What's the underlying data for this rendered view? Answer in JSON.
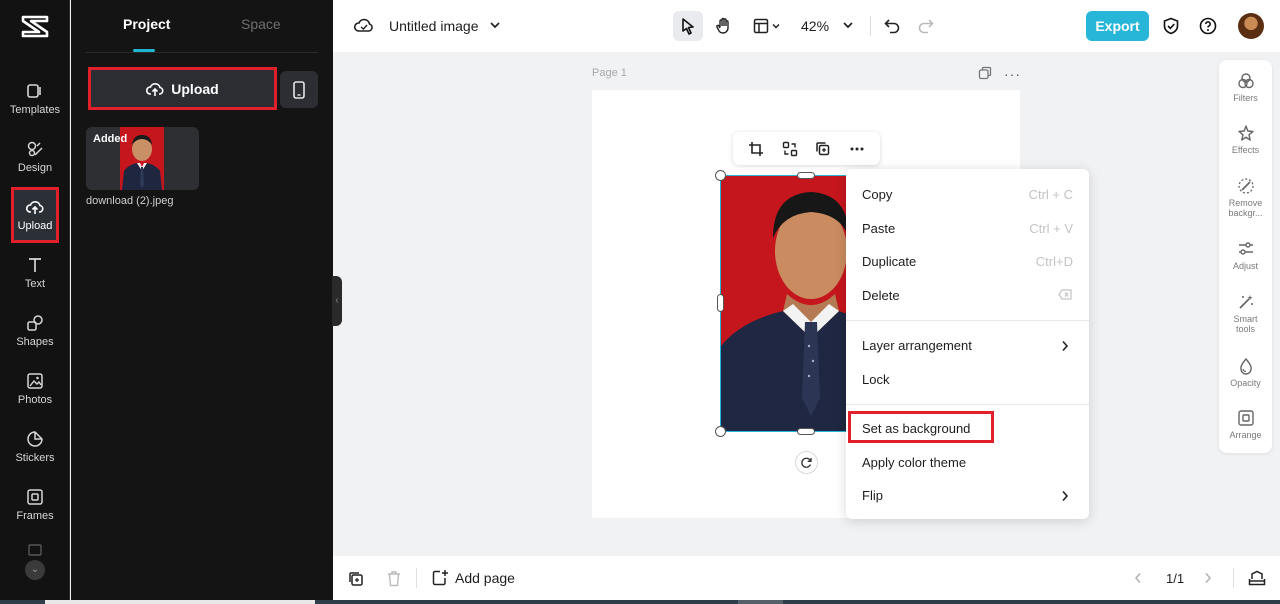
{
  "rail": {
    "items": [
      {
        "label": "Templates",
        "icon": "templates-icon"
      },
      {
        "label": "Design",
        "icon": "design-icon"
      },
      {
        "label": "Upload",
        "icon": "upload-cloud-icon",
        "active": true
      },
      {
        "label": "Text",
        "icon": "text-icon"
      },
      {
        "label": "Shapes",
        "icon": "shapes-icon"
      },
      {
        "label": "Photos",
        "icon": "photos-icon"
      },
      {
        "label": "Stickers",
        "icon": "stickers-icon"
      },
      {
        "label": "Frames",
        "icon": "frames-icon"
      }
    ]
  },
  "panel": {
    "tabs": [
      {
        "label": "Project",
        "active": true
      },
      {
        "label": "Space",
        "active": false
      }
    ],
    "upload_label": "Upload",
    "asset": {
      "badge": "Added",
      "filename": "download (2).jpeg"
    }
  },
  "topbar": {
    "title": "Untitled image",
    "zoom": "42%",
    "export_label": "Export"
  },
  "canvas": {
    "page_label": "Page 1"
  },
  "context_menu": {
    "items": [
      {
        "label": "Copy",
        "shortcut": "Ctrl + C"
      },
      {
        "label": "Paste",
        "shortcut": "Ctrl + V"
      },
      {
        "label": "Duplicate",
        "shortcut": "Ctrl+D"
      },
      {
        "label": "Delete"
      },
      {
        "label": "Layer arrangement",
        "submenu": true
      },
      {
        "label": "Lock"
      },
      {
        "label": "Set as background",
        "highlighted": true
      },
      {
        "label": "Apply color theme"
      },
      {
        "label": "Flip",
        "submenu": true
      }
    ]
  },
  "right_tools": {
    "items": [
      {
        "label": "Filters",
        "icon": "filters-icon"
      },
      {
        "label": "Effects",
        "icon": "effects-icon"
      },
      {
        "label": "Remove backgr...",
        "icon": "remove-background-icon"
      },
      {
        "label": "Adjust",
        "icon": "adjust-icon"
      },
      {
        "label": "Smart tools",
        "icon": "smart-tools-icon"
      },
      {
        "label": "Opacity",
        "icon": "opacity-icon"
      },
      {
        "label": "Arrange",
        "icon": "arrange-icon"
      }
    ]
  },
  "bottombar": {
    "add_page_label": "Add page",
    "page_count": "1/1"
  },
  "colors": {
    "accent": "#27b5d8",
    "highlight_box": "#e2202b",
    "sidebar_bg": "#121212",
    "photo_backdrop": "#c4161c"
  }
}
